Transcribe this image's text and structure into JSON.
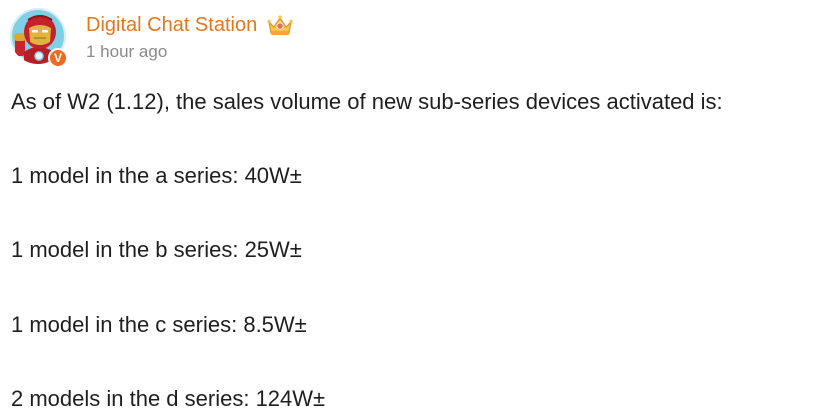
{
  "post": {
    "author": {
      "name": "Digital Chat Station",
      "verified_badge": "V",
      "avatar_icon": "iron-man-avatar-icon",
      "rank_icon": "crown-badge-icon"
    },
    "timestamp": "1 hour ago",
    "paragraphs": [
      "As of W2 (1.12), the sales volume of new sub-series devices activated is:",
      "1 model in the a series: 40W±",
      "1 model in the b series: 25W±",
      "1 model in the c series: 8.5W±",
      "2 models in the d series: 124W±"
    ]
  },
  "colors": {
    "author_name": "#e8761a",
    "timestamp": "#8a8a8a",
    "verified_badge": "#f0691f",
    "text": "#1f1f1f"
  }
}
